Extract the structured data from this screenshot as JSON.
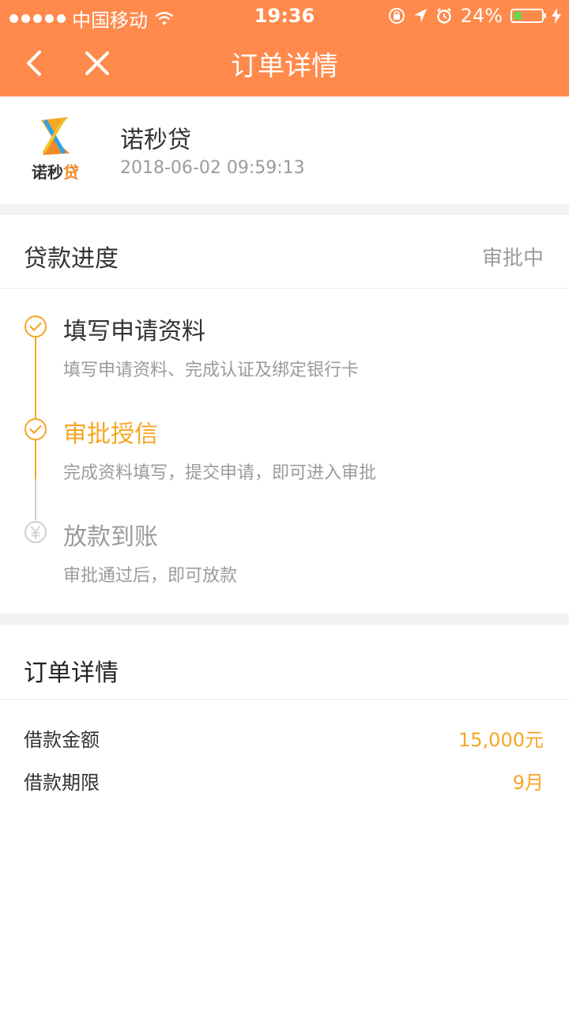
{
  "status_bar": {
    "carrier": "中国移动",
    "time": "19:36",
    "battery": "24%"
  },
  "nav": {
    "title": "订单详情"
  },
  "merchant": {
    "name": "诺秒贷",
    "datetime": "2018-06-02 09:59:13",
    "logo_text_main": "诺秒",
    "logo_text_accent": "贷"
  },
  "loan_progress": {
    "label": "贷款进度",
    "status": "审批中",
    "steps": [
      {
        "title": "填写申请资料",
        "desc": "填写申请资料、完成认证及绑定银行卡"
      },
      {
        "title": "审批授信",
        "desc": "完成资料填写，提交申请，即可进入审批"
      },
      {
        "title": "放款到账",
        "desc": "审批通过后，即可放款"
      }
    ]
  },
  "order_detail": {
    "label": "订单详情",
    "rows": [
      {
        "key": "借款金额",
        "value": "15,000元"
      },
      {
        "key": "借款期限",
        "value": "9月"
      }
    ]
  },
  "colors": {
    "header_bg": "#FF8A4C",
    "accent": "#F5A623",
    "inactive": "#C8C8C8"
  }
}
